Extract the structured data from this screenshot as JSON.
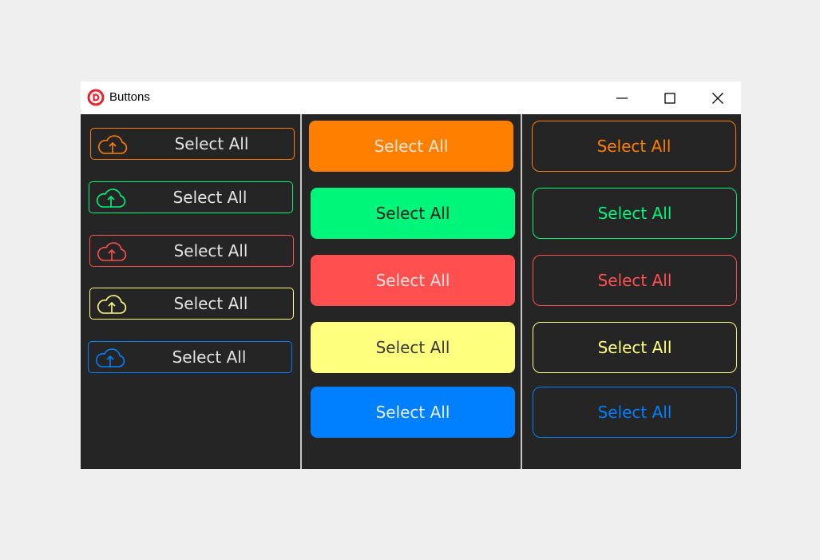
{
  "window": {
    "title": "Buttons",
    "logo_icon": "app-logo-icon",
    "controls": [
      "minimize-icon",
      "maximize-icon",
      "close-icon"
    ]
  },
  "colors": {
    "orange": "#ff7f00",
    "green": "#00f57b",
    "red": "#ff4f4f",
    "yellow": "#ffff7f",
    "blue": "#007fff",
    "background": "#252525",
    "titlebar": "#ffffff"
  },
  "icon_buttons": [
    {
      "label": "Select All",
      "icon": "cloud-upload-icon",
      "color": "orange"
    },
    {
      "label": "Select All",
      "icon": "cloud-upload-icon",
      "color": "green"
    },
    {
      "label": "Select All",
      "icon": "cloud-upload-icon",
      "color": "red"
    },
    {
      "label": "Select All",
      "icon": "cloud-upload-icon",
      "color": "yellow"
    },
    {
      "label": "Select All",
      "icon": "cloud-upload-icon",
      "color": "blue"
    }
  ],
  "filled_buttons": [
    {
      "label": "Select All",
      "color": "orange"
    },
    {
      "label": "Select All",
      "color": "green"
    },
    {
      "label": "Select All",
      "color": "red"
    },
    {
      "label": "Select All",
      "color": "yellow"
    },
    {
      "label": "Select All",
      "color": "blue"
    }
  ],
  "outline_buttons": [
    {
      "label": "Select All",
      "color": "orange"
    },
    {
      "label": "Select All",
      "color": "green"
    },
    {
      "label": "Select All",
      "color": "red"
    },
    {
      "label": "Select All",
      "color": "yellow"
    },
    {
      "label": "Select All",
      "color": "blue"
    }
  ]
}
